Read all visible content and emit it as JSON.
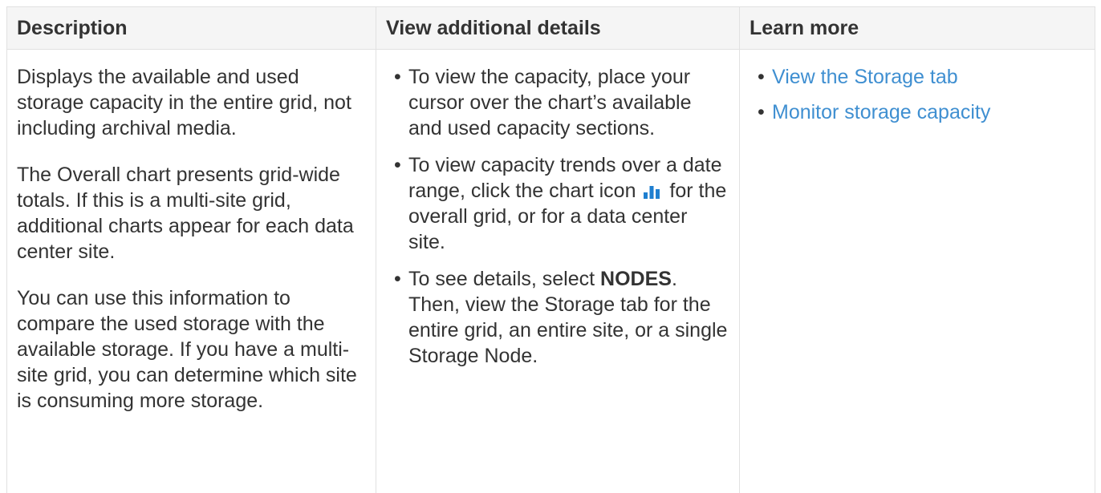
{
  "table": {
    "headers": [
      "Description",
      "View additional details",
      "Learn more"
    ],
    "description": {
      "paragraphs": [
        "Displays the available and used storage capacity in the entire grid, not including archival media.",
        "The Overall chart presents grid-wide totals. If this is a multi-site grid, additional charts appear for each data center site.",
        "You can use this information to compare the used storage with the available storage. If you have a multi-site grid, you can determine which site is consuming more storage."
      ]
    },
    "details": {
      "item1": "To view the capacity, place your cursor over the chart’s available and used capacity sections.",
      "item2_before_icon": "To view capacity trends over a date range, click the chart icon",
      "item2_after_icon": "for the overall grid, or for a data center site.",
      "item3_before_bold": "To see details, select",
      "item3_bold": "NODES",
      "item3_after_bold": ". Then, view the Storage tab for the entire grid, an entire site, or a single Storage Node."
    },
    "learn_more": {
      "links": [
        "View the Storage tab",
        "Monitor storage capacity"
      ]
    }
  },
  "icons": {
    "chart_icon": "bar-chart-icon"
  },
  "colors": {
    "link": "#3f8fd1",
    "header_bg": "#f5f5f5",
    "chart_icon": "#1e7fd0"
  }
}
